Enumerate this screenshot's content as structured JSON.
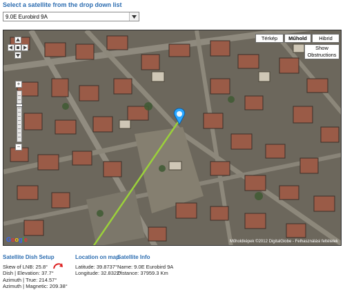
{
  "page": {
    "prompt": "Select a satellite from the drop down list"
  },
  "satellite_select": {
    "selected": "9.0E Eurobird 9A"
  },
  "map": {
    "map_types": [
      "Térkép",
      "Műhold",
      "Hibrid"
    ],
    "active_map_type": "Műhold",
    "show_obstructions": "Show\nObstructions",
    "logo": "Google",
    "attribution": "Műholdképek ©2012 DigitalGlobe - Felhasználási feltételek"
  },
  "dish_setup": {
    "heading": "Satellite Dish Setup",
    "lines": [
      "Skew of LNB: 25.8°",
      "Dish | Elevation: 37.7°",
      "Azimuth | True: 214.57°",
      "Azimuth | Magnetic: 209.38°"
    ]
  },
  "location": {
    "heading": "Location on map",
    "lines": [
      "Latitude: 39.8737°",
      "Longitude: 32.8322°"
    ]
  },
  "satellite_info": {
    "heading": "Satellite Info",
    "lines": [
      "Name: 9.0E Eurobird 9A",
      "Distance: 37959.3 Km"
    ]
  },
  "colors": {
    "accent": "#2b6cb0",
    "pointer_line": "#9bd13a",
    "marker": "#2aa7ff"
  }
}
